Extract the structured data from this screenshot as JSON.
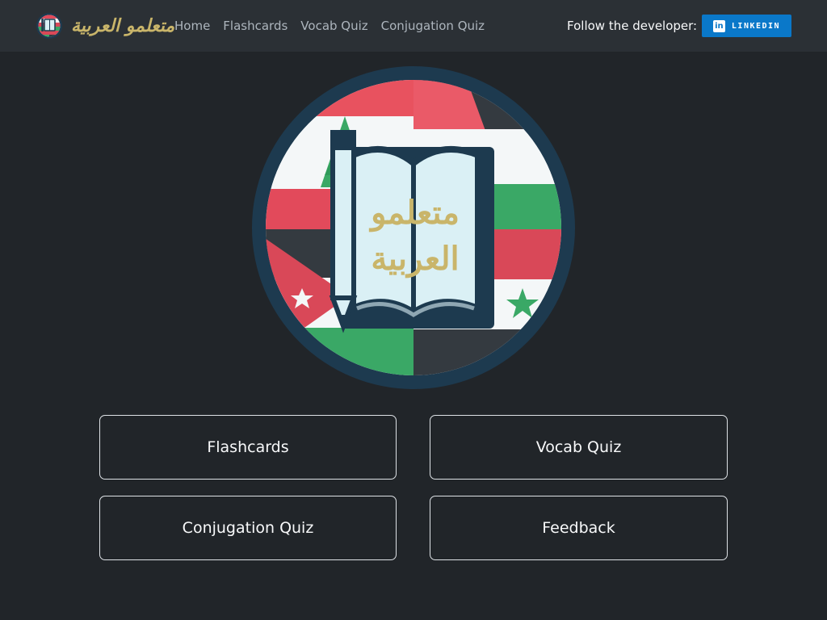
{
  "navbar": {
    "brand_text": "متعلمو العربية",
    "links": [
      {
        "label": "Home"
      },
      {
        "label": "Flashcards"
      },
      {
        "label": "Vocab Quiz"
      },
      {
        "label": "Conjugation Quiz"
      }
    ],
    "follow_text": "Follow the developer:",
    "linkedin_label": "LINKEDIN",
    "linkedin_icon_text": "in"
  },
  "hero": {
    "logo_line1": "متعلمو",
    "logo_line2": "العربية"
  },
  "buttons": {
    "flashcards": "Flashcards",
    "vocab_quiz": "Vocab Quiz",
    "conjugation_quiz": "Conjugation Quiz",
    "feedback": "Feedback"
  },
  "colors": {
    "background": "#212529",
    "navbar": "#2b3035",
    "linkedin": "#0a78c9",
    "logo_gold": "#c9b56a",
    "logo_ring": "#1d3a4f"
  },
  "icons": {
    "brand": "arabic-learners-logo-icon",
    "linkedin": "linkedin-icon",
    "hero": "arabic-learners-book-logo"
  }
}
